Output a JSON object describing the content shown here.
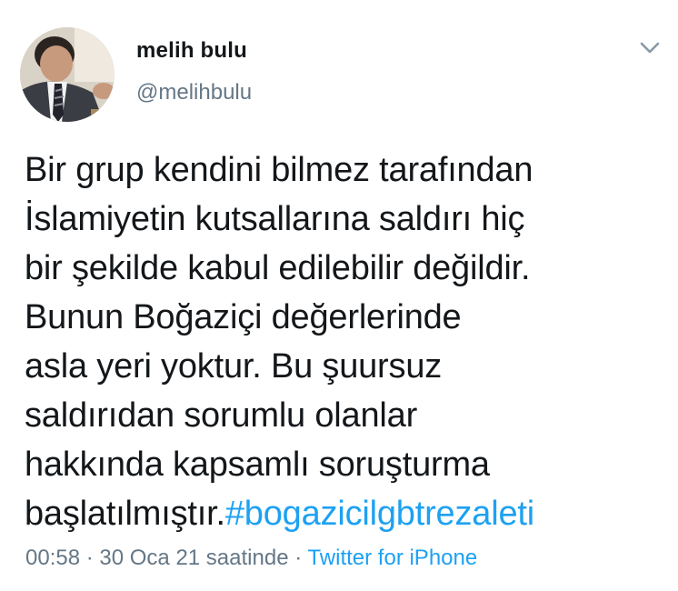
{
  "user": {
    "display_name": "melih bulu",
    "handle": "@melihbulu"
  },
  "tweet": {
    "lines": [
      "Bir grup kendini bilmez tarafından",
      "İslamiyetin kutsallarına saldırı hiç",
      "bir şekilde kabul edilebilir değildir.",
      "Bunun Boğaziçi değerlerinde",
      "asla yeri yoktur. Bu şuursuz",
      "saldırıdan sorumlu olanlar",
      "hakkında kapsamlı soruşturma"
    ],
    "last_line_text": "başlatılmıştır.",
    "hashtag": "#bogazicilgbtrezaleti"
  },
  "meta": {
    "time": "00:58",
    "separator": " · ",
    "date": "30 Oca 21 saatinde",
    "source": "Twitter for iPhone"
  },
  "icons": {
    "menu": "chevron-down-icon",
    "avatar": "profile-photo"
  },
  "colors": {
    "link": "#1da1f2",
    "secondary_text": "#657786",
    "primary_text": "#14171a"
  }
}
